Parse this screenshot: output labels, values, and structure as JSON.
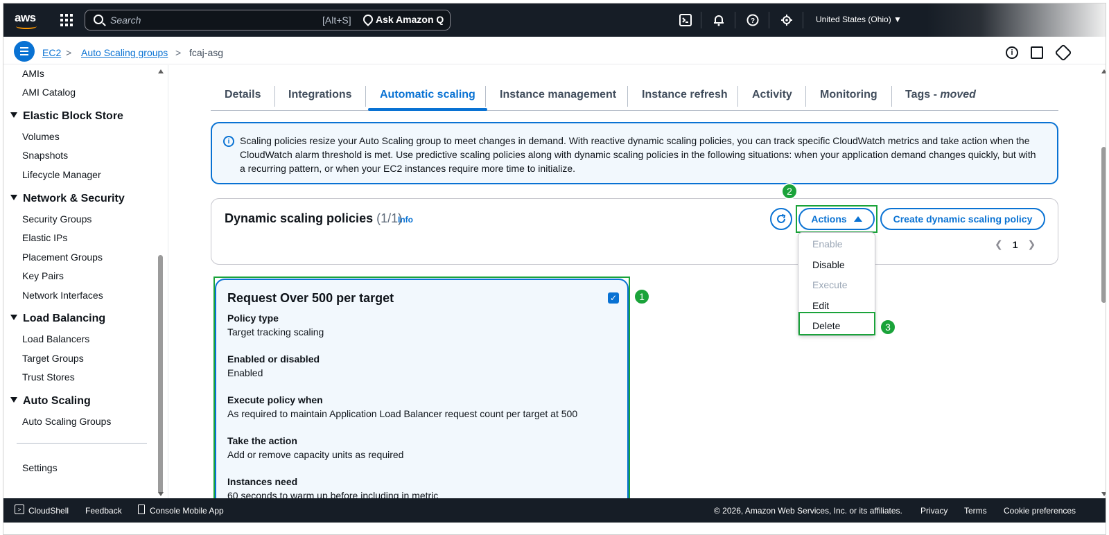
{
  "topnav": {
    "logo": "aws",
    "search_placeholder": "Search",
    "search_shortcut": "[Alt+S]",
    "ask_q": "Ask Amazon Q",
    "region": "United States (Ohio) ▼"
  },
  "breadcrumb": {
    "items": [
      "EC2",
      "Auto Scaling groups",
      "fcaj-asg"
    ]
  },
  "sidebar": {
    "items_top": [
      "AMIs",
      "AMI Catalog"
    ],
    "sections": [
      {
        "title": "Elastic Block Store",
        "items": [
          "Volumes",
          "Snapshots",
          "Lifecycle Manager"
        ]
      },
      {
        "title": "Network & Security",
        "items": [
          "Security Groups",
          "Elastic IPs",
          "Placement Groups",
          "Key Pairs",
          "Network Interfaces"
        ]
      },
      {
        "title": "Load Balancing",
        "items": [
          "Load Balancers",
          "Target Groups",
          "Trust Stores"
        ]
      },
      {
        "title": "Auto Scaling",
        "items": [
          "Auto Scaling Groups"
        ]
      }
    ],
    "settings": "Settings"
  },
  "tabs": [
    "Details",
    "Integrations",
    "Automatic scaling",
    "Instance management",
    "Instance refresh",
    "Activity",
    "Monitoring",
    "Tags - ",
    "moved"
  ],
  "alert": {
    "text": "Scaling policies resize your Auto Scaling group to meet changes in demand. With reactive dynamic scaling policies, you can track specific CloudWatch metrics and take action when the CloudWatch alarm threshold is met. Use predictive scaling policies along with dynamic scaling policies in the following situations: when your application demand changes quickly, but with a recurring pattern, or when your EC2 instances require more time to initialize."
  },
  "policies": {
    "title": "Dynamic scaling policies",
    "count": "(1/1)",
    "info": "Info",
    "actions_label": "Actions",
    "create_label": "Create dynamic scaling policy",
    "page": "1"
  },
  "dropdown": {
    "items": [
      "Enable",
      "Disable",
      "Execute",
      "Edit",
      "Delete"
    ]
  },
  "badges": [
    "1",
    "2",
    "3"
  ],
  "policy_card": {
    "title": "Request Over 500 per target",
    "fields": [
      {
        "label": "Policy type",
        "value": "Target tracking scaling"
      },
      {
        "label": "Enabled or disabled",
        "value": "Enabled"
      },
      {
        "label": "Execute policy when",
        "value": "As required to maintain Application Load Balancer request count per target at 500"
      },
      {
        "label": "Take the action",
        "value": "Add or remove capacity units as required"
      },
      {
        "label": "Instances need",
        "value": "60 seconds to warm up before including in metric"
      }
    ]
  },
  "footer": {
    "cloudshell": "CloudShell",
    "feedback": "Feedback",
    "mobile": "Console Mobile App",
    "copyright": "© 2026, Amazon Web Services, Inc. or its affiliates.",
    "privacy": "Privacy",
    "terms": "Terms",
    "cookies": "Cookie preferences"
  },
  "colors": {
    "nav_bg": "#161d26",
    "link_blue": "#0972d3",
    "highlight_green": "#1aa33a",
    "card_bg": "#f2f8fd"
  }
}
